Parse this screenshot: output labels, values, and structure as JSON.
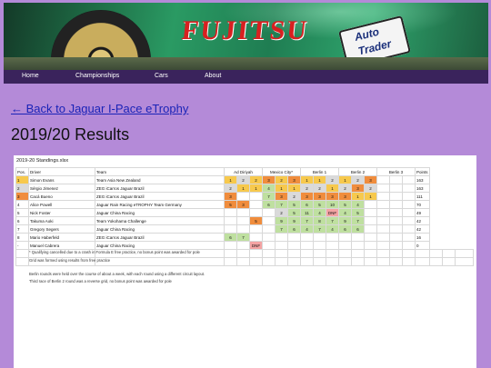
{
  "banner": {
    "brand": "FUJITSU",
    "sponsor_line1": "Auto",
    "sponsor_line2": "Trader"
  },
  "nav": [
    "Home",
    "Championships",
    "Cars",
    "About"
  ],
  "back_link": "← Back to Jaguar I-Pace eTrophy",
  "page_title": "2019/20 Results",
  "sheet": {
    "title": "2019-20 Standings.xlsx",
    "headers": [
      "Pos.",
      "Driver",
      "Team",
      "Ad Diriyah",
      "Mexico City*",
      "Berlin 1",
      "Berlin 2",
      "Berlin 3",
      "Points"
    ],
    "rows": [
      {
        "pos": "1",
        "driver": "Simon Evans",
        "team": "Team Asia New Zealand",
        "cells": [
          [
            "1",
            "y"
          ],
          [
            "2",
            "gr"
          ],
          [
            "2",
            "y"
          ],
          [
            "3",
            "o"
          ],
          [
            "2",
            "y"
          ],
          [
            "3",
            "o"
          ],
          [
            "1",
            "y"
          ],
          [
            "1",
            "y"
          ],
          [
            "2",
            "gr"
          ],
          [
            "1",
            "y"
          ],
          [
            "2",
            "gr"
          ],
          [
            "3",
            "o"
          ]
        ],
        "points": "163"
      },
      {
        "pos": "2",
        "driver": "Sérgio Jimenez",
        "team": "ZEG iCarros Jaguar Brazil",
        "cells": [
          [
            "2",
            "gr"
          ],
          [
            "1",
            "y"
          ],
          [
            "1",
            "y"
          ],
          [
            "4",
            "g"
          ],
          [
            "1",
            "y"
          ],
          [
            "1",
            "y"
          ],
          [
            "2",
            "gr"
          ],
          [
            "2",
            "gr"
          ],
          [
            "1",
            "y"
          ],
          [
            "2",
            "gr"
          ],
          [
            "3",
            "o"
          ],
          [
            "2",
            "gr"
          ]
        ],
        "points": "163"
      },
      {
        "pos": "3",
        "driver": "Cacá Bueno",
        "team": "ZEG iCarros Jaguar Brazil",
        "cells": [
          [
            "3",
            "o"
          ],
          [
            "",
            ""
          ],
          [
            "",
            ""
          ],
          [
            "7",
            "g"
          ],
          [
            "3",
            "o"
          ],
          [
            "2",
            "gr"
          ],
          [
            "3",
            "o"
          ],
          [
            "3",
            "o"
          ],
          [
            "3",
            "o"
          ],
          [
            "3",
            "o"
          ],
          [
            "1",
            "y"
          ],
          [
            "1",
            "y"
          ]
        ],
        "points": "111"
      },
      {
        "pos": "4",
        "driver": "Alice Powell",
        "team": "Jaguar Rain Racing eTROPHY Team Germany",
        "cells": [
          [
            "5",
            "o"
          ],
          [
            "3",
            "o"
          ],
          [
            "",
            ""
          ],
          [
            "6",
            "g"
          ],
          [
            "7",
            "g"
          ],
          [
            "5",
            "g"
          ],
          [
            "6",
            "g"
          ],
          [
            "5",
            "g"
          ],
          [
            "10",
            "g"
          ],
          [
            "5",
            "g"
          ],
          [
            "4",
            "g"
          ],
          [
            "",
            ""
          ]
        ],
        "points": "70"
      },
      {
        "pos": "5",
        "driver": "Nick Foster",
        "team": "Jaguar China Racing",
        "cells": [
          [
            "",
            ""
          ],
          [
            "",
            ""
          ],
          [
            "",
            ""
          ],
          [
            "",
            ""
          ],
          [
            "2",
            "gr"
          ],
          [
            "5",
            "g"
          ],
          [
            "11",
            "g"
          ],
          [
            "4",
            "g"
          ],
          [
            "DNF",
            "r"
          ],
          [
            "4",
            "g"
          ],
          [
            "5",
            "g"
          ],
          [
            "",
            ""
          ]
        ],
        "points": "49"
      },
      {
        "pos": "6",
        "driver": "Takuma Aoki",
        "team": "Team Yokohama Challenge",
        "cells": [
          [
            "",
            ""
          ],
          [
            "",
            ""
          ],
          [
            "5",
            "o"
          ],
          [
            "",
            ""
          ],
          [
            "9",
            "g"
          ],
          [
            "9",
            "g"
          ],
          [
            "7",
            "g"
          ],
          [
            "8",
            "g"
          ],
          [
            "7",
            "g"
          ],
          [
            "9",
            "g"
          ],
          [
            "7",
            "g"
          ],
          [
            "",
            ""
          ]
        ],
        "points": "42"
      },
      {
        "pos": "7",
        "driver": "Gregory Segers",
        "team": "Jaguar China Racing",
        "cells": [
          [
            "",
            ""
          ],
          [
            "",
            ""
          ],
          [
            "",
            ""
          ],
          [
            "",
            ""
          ],
          [
            "7",
            "g"
          ],
          [
            "6",
            "g"
          ],
          [
            "4",
            "g"
          ],
          [
            "7",
            "g"
          ],
          [
            "4",
            "g"
          ],
          [
            "6",
            "g"
          ],
          [
            "6",
            "g"
          ],
          [
            "",
            ""
          ]
        ],
        "points": "42"
      },
      {
        "pos": "8",
        "driver": "Mario Haberfeld",
        "team": "ZEG iCarros Jaguar Brazil",
        "cells": [
          [
            "6",
            "g"
          ],
          [
            "7",
            "g"
          ],
          [
            "",
            ""
          ],
          [
            "",
            ""
          ],
          [
            "",
            ""
          ],
          [
            "",
            ""
          ],
          [
            "",
            ""
          ],
          [
            "",
            ""
          ],
          [
            "",
            ""
          ],
          [
            "",
            ""
          ],
          [
            "",
            ""
          ],
          [
            "",
            ""
          ]
        ],
        "points": "16"
      },
      {
        "pos": "-",
        "driver": "Manuel Cabrera",
        "team": "Jaguar China Racing",
        "cells": [
          [
            "",
            ""
          ],
          [
            "",
            ""
          ],
          [
            "DNF",
            "r"
          ],
          [
            "",
            ""
          ],
          [
            "",
            ""
          ],
          [
            "",
            ""
          ],
          [
            "",
            ""
          ],
          [
            "",
            ""
          ],
          [
            "",
            ""
          ],
          [
            "",
            ""
          ],
          [
            "",
            ""
          ],
          [
            "",
            ""
          ]
        ],
        "points": "0"
      }
    ],
    "notes": [
      "* Qualifying cancelled due to a crash in Formula E free practice, no bonus point was awarded for pole",
      "Grid was formed using results from free practice",
      "Berlin rounds were held over the course of about a week, with each round using a different circuit layout.",
      "Third race of Berlin 2 round was a reverse grid, no bonus point was awarded for pole"
    ]
  }
}
